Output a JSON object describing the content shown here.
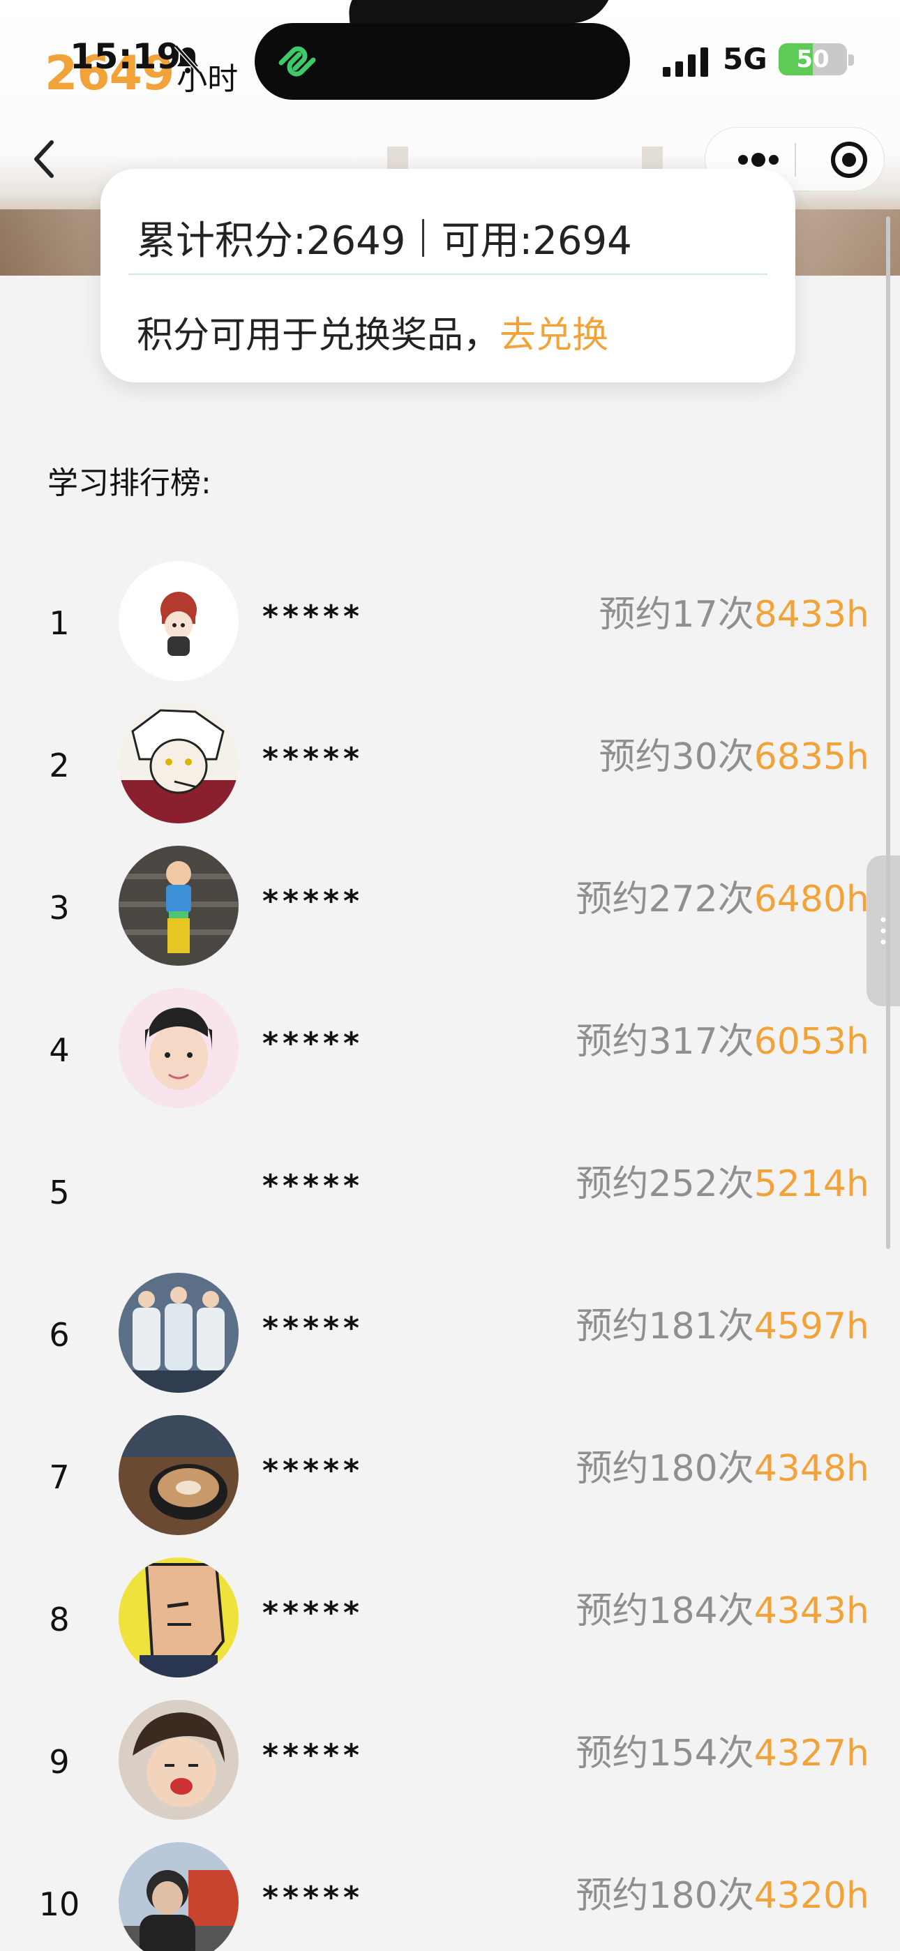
{
  "status_bar": {
    "time": "15:19",
    "network": "5G",
    "battery": "50",
    "battery_level": 0.5,
    "mute_icon": "bell-slash-icon",
    "signal_icon": "cellular-signal-icon"
  },
  "header": {
    "total_hours": "2649",
    "hours_unit": "小时"
  },
  "nav": {
    "back_icon": "chevron-left-icon",
    "more_icon": "more-dots-icon",
    "close_icon": "target-close-icon"
  },
  "points": {
    "total_label": "累计积分:2649",
    "available_label": "可用:2694",
    "hint": "积分可用于兑换奖品，",
    "exchange_link": "去兑换"
  },
  "leaderboard": {
    "title": "学习排行榜:",
    "rows": [
      {
        "rank": "1",
        "name": "*****",
        "count": "预约17次",
        "hours": "8433h"
      },
      {
        "rank": "2",
        "name": "*****",
        "count": "预约30次",
        "hours": "6835h"
      },
      {
        "rank": "3",
        "name": "*****",
        "count": "预约272次",
        "hours": "6480h"
      },
      {
        "rank": "4",
        "name": "*****",
        "count": "预约317次",
        "hours": "6053h"
      },
      {
        "rank": "5",
        "name": "*****",
        "count": "预约252次",
        "hours": "5214h"
      },
      {
        "rank": "6",
        "name": "*****",
        "count": "预约181次",
        "hours": "4597h"
      },
      {
        "rank": "7",
        "name": "*****",
        "count": "预约180次",
        "hours": "4348h"
      },
      {
        "rank": "8",
        "name": "*****",
        "count": "预约184次",
        "hours": "4343h"
      },
      {
        "rank": "9",
        "name": "*****",
        "count": "预约154次",
        "hours": "4327h"
      },
      {
        "rank": "10",
        "name": "*****",
        "count": "预约180次",
        "hours": "4320h"
      }
    ]
  },
  "colors": {
    "accent": "#f1a33a",
    "muted_text": "#8f8f8f",
    "background": "#f3f3f3",
    "battery_green": "#5fcb57"
  }
}
